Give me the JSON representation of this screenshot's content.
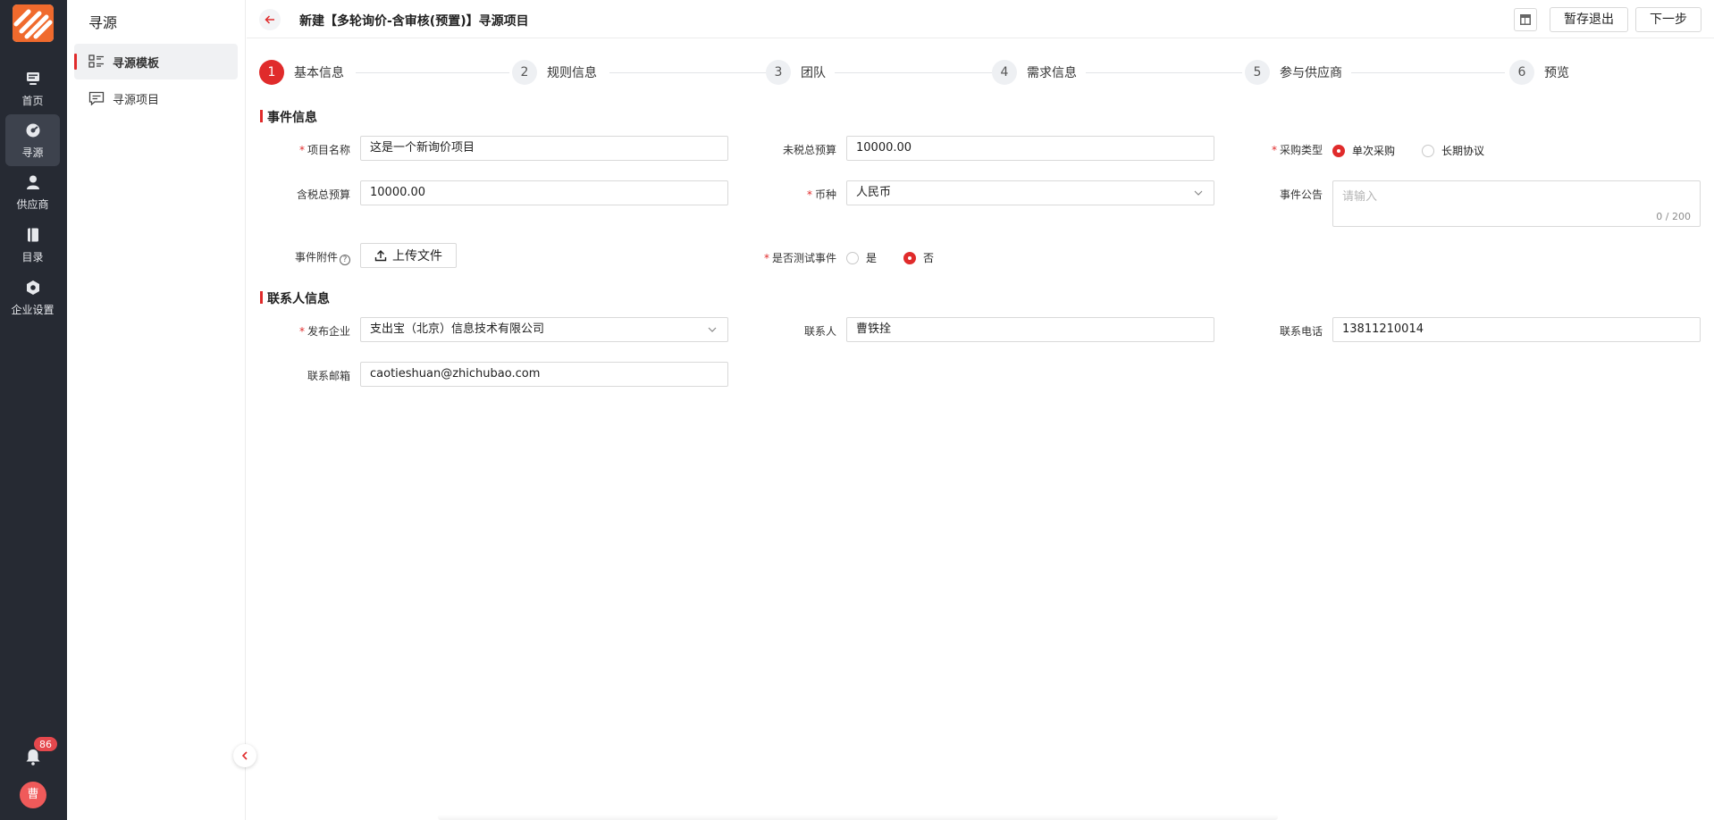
{
  "rail": {
    "items": [
      {
        "label": "首页",
        "icon": "monitor-icon"
      },
      {
        "label": "寻源",
        "icon": "compass-icon"
      },
      {
        "label": "供应商",
        "icon": "person-icon"
      },
      {
        "label": "目录",
        "icon": "book-icon"
      },
      {
        "label": "企业设置",
        "icon": "hexagon-gear-icon"
      }
    ],
    "notification_count": "86",
    "avatar_text": "曹"
  },
  "subnav": {
    "title": "寻源",
    "items": [
      {
        "label": "寻源模板",
        "icon": "template-list-icon"
      },
      {
        "label": "寻源项目",
        "icon": "project-message-icon"
      }
    ]
  },
  "header": {
    "title": "新建【多轮询价-含审核(预置)】寻源项目",
    "save_label": "暂存退出",
    "next_label": "下一步"
  },
  "steps": [
    {
      "num": "1",
      "label": "基本信息"
    },
    {
      "num": "2",
      "label": "规则信息"
    },
    {
      "num": "3",
      "label": "团队"
    },
    {
      "num": "4",
      "label": "需求信息"
    },
    {
      "num": "5",
      "label": "参与供应商"
    },
    {
      "num": "6",
      "label": "预览"
    }
  ],
  "event": {
    "section_title": "事件信息",
    "project_name": {
      "label": "项目名称",
      "value": "这是一个新询价项目"
    },
    "pretax_budget": {
      "label": "未税总预算",
      "value": "10000.00"
    },
    "purchase_type": {
      "label": "采购类型",
      "options": [
        "单次采购",
        "长期协议"
      ],
      "selected": "单次采购"
    },
    "tax_budget": {
      "label": "含税总预算",
      "value": "10000.00"
    },
    "currency": {
      "label": "币种",
      "value": "人民币"
    },
    "announcement": {
      "label": "事件公告",
      "placeholder": "请输入",
      "count": "0 / 200"
    },
    "attachment": {
      "label": "事件附件",
      "help": "?",
      "button": "上传文件"
    },
    "test_event": {
      "label": "是否测试事件",
      "options": [
        "是",
        "否"
      ],
      "selected": "否"
    }
  },
  "contact": {
    "section_title": "联系人信息",
    "company": {
      "label": "发布企业",
      "value": "支出宝（北京）信息技术有限公司"
    },
    "person": {
      "label": "联系人",
      "value": "曹铁拴"
    },
    "phone": {
      "label": "联系电话",
      "value": "13811210014"
    },
    "email": {
      "label": "联系邮箱",
      "value": "caotieshuan@zhichubao.com"
    }
  },
  "colors": {
    "accent": "#e02b2b",
    "rail": "#262a33"
  }
}
